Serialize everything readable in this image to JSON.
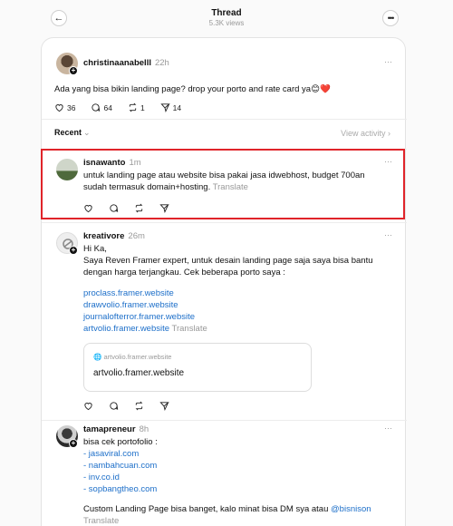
{
  "header": {
    "title": "Thread",
    "views": "5.3K views"
  },
  "main_post": {
    "username": "christinaanabelll",
    "time": "22h",
    "text": "Ada yang bisa bikin landing page? drop your porto and rate card ya😊❤️",
    "likes": "36",
    "replies": "64",
    "reposts": "1",
    "shares": "14"
  },
  "replies_header": {
    "sort_label": "Recent",
    "view_activity": "View activity ›"
  },
  "replies": [
    {
      "username": "isnawanto",
      "time": "1m",
      "text": "untuk landing page atau website bisa pakai jasa idwebhost, budget 700an sudah termasuk domain+hosting.",
      "translate": "Translate"
    },
    {
      "username": "kreativore",
      "time": "26m",
      "greeting": "Hi Ka,",
      "text": "Saya Reven Framer expert, untuk desain landing page saja saya bisa bantu dengan harga terjangkau. Cek beberapa porto saya :",
      "links": [
        "proclass.framer.website",
        "drawvolio.framer.website",
        "journalofterror.framer.website",
        "artvolio.framer.website"
      ],
      "translate": "Translate",
      "link_card": {
        "domain": "artvolio.framer.website",
        "title": "artvolio.framer.website"
      }
    },
    {
      "username": "tamapreneur",
      "time": "8h",
      "intro": "bisa cek portofolio :",
      "links": [
        "- jasaviral.com",
        "- nambahcuan.com",
        "- inv.co.id",
        "- sopbangtheo.com"
      ],
      "text": "Custom Landing Page bisa banget, kalo minat bisa DM sya atau",
      "mention": "@bisnison",
      "translate": "Translate"
    }
  ]
}
